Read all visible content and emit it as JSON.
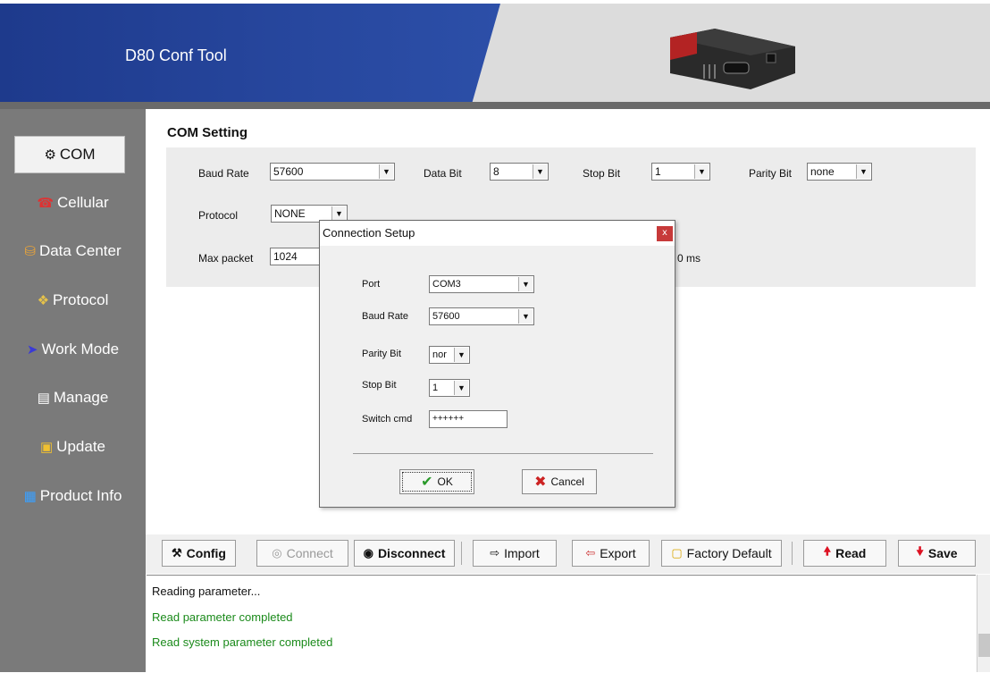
{
  "app": {
    "title": "D80 Conf Tool"
  },
  "sidebar": {
    "items": [
      {
        "label": "COM",
        "icon": "com-port-icon"
      },
      {
        "label": "Cellular",
        "icon": "cellular-icon"
      },
      {
        "label": "Data Center",
        "icon": "data-center-icon"
      },
      {
        "label": "Protocol",
        "icon": "protocol-icon"
      },
      {
        "label": "Work Mode",
        "icon": "arrow-right-icon"
      },
      {
        "label": "Manage",
        "icon": "manage-icon"
      },
      {
        "label": "Update",
        "icon": "update-icon"
      },
      {
        "label": "Product Info",
        "icon": "product-info-icon"
      }
    ],
    "active": "COM"
  },
  "com": {
    "title": "COM Setting",
    "baud_rate_label": "Baud Rate",
    "baud_rate_value": "57600",
    "data_bit_label": "Data Bit",
    "data_bit_value": "8",
    "stop_bit_label": "Stop Bit",
    "stop_bit_value": "1",
    "parity_bit_label": "Parity Bit",
    "parity_bit_value": "none",
    "protocol_label": "Protocol",
    "protocol_value": "NONE",
    "max_packet_label": "Max packet",
    "max_packet_value": "1024",
    "partial_unit": "0 ms"
  },
  "dialog": {
    "title": "Connection Setup",
    "close": "x",
    "port_label": "Port",
    "port_value": "COM3",
    "baud_label": "Baud Rate",
    "baud_value": "57600",
    "parity_label": "Parity Bit",
    "parity_value": "nor",
    "stop_label": "Stop Bit",
    "stop_value": "1",
    "switch_label": "Switch cmd",
    "switch_value": "++++++",
    "ok_label": "OK",
    "cancel_label": "Cancel"
  },
  "toolbar": {
    "config": "Config",
    "connect": "Connect",
    "disconnect": "Disconnect",
    "import": "Import",
    "export": "Export",
    "factory_default": "Factory Default",
    "read": "Read",
    "save": "Save"
  },
  "log": {
    "lines": [
      {
        "text": "Reading parameter...",
        "color": "#111111"
      },
      {
        "text": "Read parameter completed",
        "color": "#1a8a1a"
      },
      {
        "text": "Read system parameter completed",
        "color": "#1a8a1a"
      }
    ]
  },
  "colors": {
    "header_blue": "#27479e",
    "sidebar_grey": "#7a7a7a",
    "success_green": "#1a8a1a",
    "close_red": "#c73a3a"
  }
}
